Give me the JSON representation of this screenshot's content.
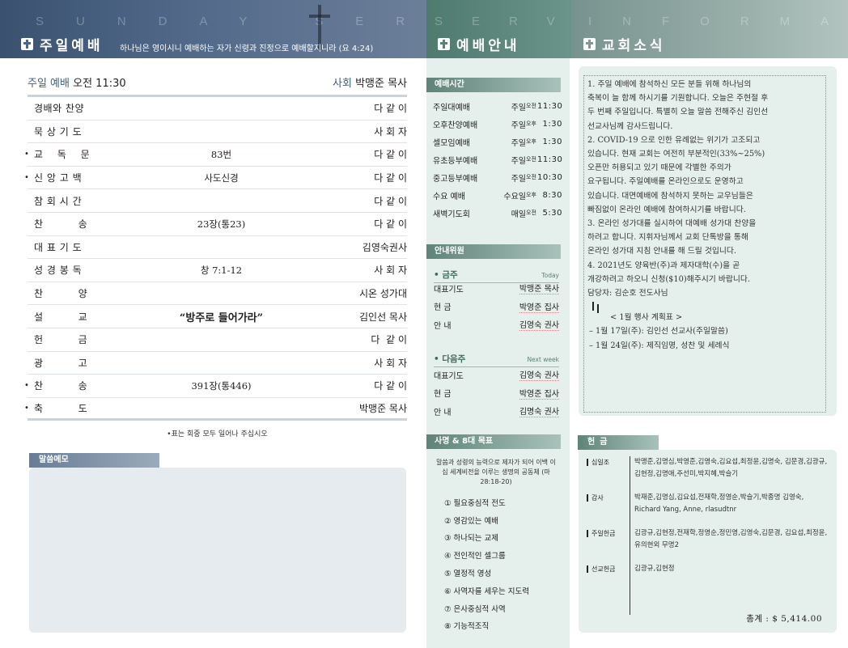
{
  "header": {
    "worship": {
      "watermark": "SUNDAY SERVICE",
      "title": "주일예배",
      "verse": "하나님은 영이시니 예배하는 자가 신령과 진정으로 예배할지니라 (요 4:24)"
    },
    "service": {
      "watermark": "SERVICE",
      "title": "예배안내"
    },
    "news": {
      "watermark": "INFORMATION",
      "title": "교회소식"
    }
  },
  "order": {
    "service_label": "주일 예배",
    "service_time": "오전 11:30",
    "leader_label": "사회",
    "leader_name": "박맹준 목사",
    "rows": [
      {
        "mark": "",
        "name": "경배와 찬양",
        "mid": "",
        "right": "다 같 이"
      },
      {
        "mark": "",
        "name": "묵 상 기 도",
        "mid": "",
        "right": "사 회 자"
      },
      {
        "mark": "•",
        "name": "교    독    문",
        "mid": "83번",
        "right": "다 같 이"
      },
      {
        "mark": "•",
        "name": "신 앙 고 백",
        "mid": "사도신경",
        "right": "다 같 이"
      },
      {
        "mark": "",
        "name": "참 회 시 간",
        "mid": "",
        "right": "다 같 이"
      },
      {
        "mark": "",
        "name": "찬          송",
        "mid": "23장(통23)",
        "right": "다 같 이"
      },
      {
        "mark": "",
        "name": "대 표 기 도",
        "mid": "",
        "right": "김영숙권사"
      },
      {
        "mark": "",
        "name": "성 경 봉 독",
        "mid": "창 7:1-12",
        "right": "사 회 자"
      },
      {
        "mark": "",
        "name": "찬          양",
        "mid": "",
        "right": "시온 성가대"
      },
      {
        "mark": "",
        "name": "설          교",
        "mid": "“방주로 들어가라”",
        "right": "김인선 목사"
      },
      {
        "mark": "",
        "name": "헌          금",
        "mid": "",
        "right": "다  같 이"
      },
      {
        "mark": "",
        "name": "광          고",
        "mid": "",
        "right": "사 회 자"
      },
      {
        "mark": "•",
        "name": "찬          송",
        "mid": "391장(통446)",
        "right": "다 같 이"
      },
      {
        "mark": "•",
        "name": "축          도",
        "mid": "",
        "right": "박맹준 목사"
      }
    ],
    "note": "•표는 회중 모두 일어나 주십시오"
  },
  "memo": {
    "label": "말씀메모"
  },
  "service_info": {
    "times_label": "예배시간",
    "times": [
      {
        "name": "주일대예배",
        "day": "주일",
        "ampm": "오전",
        "time": "11:30"
      },
      {
        "name": "오후찬양예배",
        "day": "주일",
        "ampm": "오후",
        "time": "1:30"
      },
      {
        "name": "셀모임예배",
        "day": "주일",
        "ampm": "오후",
        "time": "1:30"
      },
      {
        "name": "유초등부예배",
        "day": "주일",
        "ampm": "오전",
        "time": "11:30"
      },
      {
        "name": "중고등부예배",
        "day": "주일",
        "ampm": "오전",
        "time": "10:30"
      },
      {
        "name": "수요 예배",
        "day": "수요일",
        "ampm": "오후",
        "time": "8:30"
      },
      {
        "name": "새벽기도회",
        "day": "매일",
        "ampm": "오전",
        "time": "5:30"
      }
    ],
    "guide_label": "안내위원",
    "this_week": {
      "label": "• 금주",
      "sub": "Today",
      "rows": [
        {
          "role": "대표기도",
          "person": "박맹준 목사"
        },
        {
          "role": "현     금",
          "person": "박영준 집사"
        },
        {
          "role": "안     내",
          "person": "김영숙 권사"
        }
      ]
    },
    "next_week": {
      "label": "• 다음주",
      "sub": "Next week",
      "rows": [
        {
          "role": "대표기도",
          "person": "김영숙 권사"
        },
        {
          "role": "현     금",
          "person": "박영준 집사"
        },
        {
          "role": "안     내",
          "person": "김명숙 권사"
        }
      ]
    },
    "goals_label": "사명 & 8대 목표",
    "goals_intro": "말씀과 성령의 능력으로 제자가 되어 이백 이십 세계비전을 이루는 생명의 공동체 (마 28:18-20)",
    "goals": [
      "① 필요중심적 전도",
      "② 영감있는 예배",
      "③ 하나되는 교제",
      "④ 전인적인 셀그룹",
      "⑤ 열정적 영성",
      "⑥ 사역자를 세우는 지도력",
      "⑦ 은사중심적 사역",
      "⑧ 기능적조직"
    ]
  },
  "news": {
    "lines": [
      {
        "style": "",
        "text": "1. 주일 예배에 참석하신 모든 분들 위해 하나님의"
      },
      {
        "style": "",
        "text": "축복이 늘 함께 하시기를 기원합니다. 오늘은 주현절 후"
      },
      {
        "style": "",
        "text": "두 번째 주일입니다. 특별히 오늘 말씀 전해주신 김인선"
      },
      {
        "style": "",
        "text": "선교사님께 감사드립니다."
      },
      {
        "style": "",
        "text": "2. COVID-19 으로 인한 유례없는 위기가 고조되고"
      },
      {
        "style": "",
        "text": "있습니다.  현재 교회는 여전히 부분적인(33%~25%)"
      },
      {
        "style": "",
        "text": "오픈만 허용되고 있기 때문에 각별한 주의가"
      },
      {
        "style": "",
        "text": "요구됩니다. 주일예배를 온라인으로도 운영하고"
      },
      {
        "style": "",
        "text": "있습니다. 대면예배에 참석하지 못하는 교우님들은"
      },
      {
        "style": "",
        "text": "빠짐없이 온라인 예배에 참여하시기를 바랍니다."
      },
      {
        "style": "",
        "text": "3. 온라인 성가대를 실시하여 대예배 성가대 찬양을"
      },
      {
        "style": "",
        "text": "하려고 합니다. 지휘자님께서 교회 단톡방을 통해"
      },
      {
        "style": "",
        "text": "온라인 성가대 지침 안내를 해 드릴 것입니다."
      },
      {
        "style": "",
        "text": "4. 2021년도 양육반(주)과 제자대학(수)을 곧"
      },
      {
        "style": "",
        "text": "개강하려고 하오니 신청($10)해주시기 바랍니다."
      },
      {
        "style": "",
        "text": "담당자: 김순호 전도사님"
      },
      {
        "style": "caret",
        "text": ""
      },
      {
        "style": "pad",
        "text": "< 1월 행사 계획표 >"
      },
      {
        "style": "dash",
        "text": "–   1월 17일(주): 김인선 선교사(주일말씀)"
      },
      {
        "style": "dash",
        "text": "–   1월 24일(주): 제직임명, 성찬 및 세례식"
      }
    ]
  },
  "offering": {
    "label": "헌금",
    "categories": [
      {
        "name": "십일조",
        "names": "박맹준,김명심,박영준,김영숙,김요섭,최정윤,김명숙, 김문경,김광규,김현정,김명애,주선미,박지혜,박슬기"
      },
      {
        "name": "감사",
        "names": "박재준,김명심,김요섭,전재학,정영순,박슬기,박종명 김영숙, Richard Yang, Anne, rlasudtnr"
      },
      {
        "name": "주일헌금",
        "names": "김광규,김현정,전재학,정영순,정민영,김영숙,김문경, 김요섭,최정윤,유의현외 무명2"
      },
      {
        "name": "선교헌금",
        "names": "김광규,김현정"
      }
    ],
    "total": "총계 : $ 5,414.00"
  }
}
